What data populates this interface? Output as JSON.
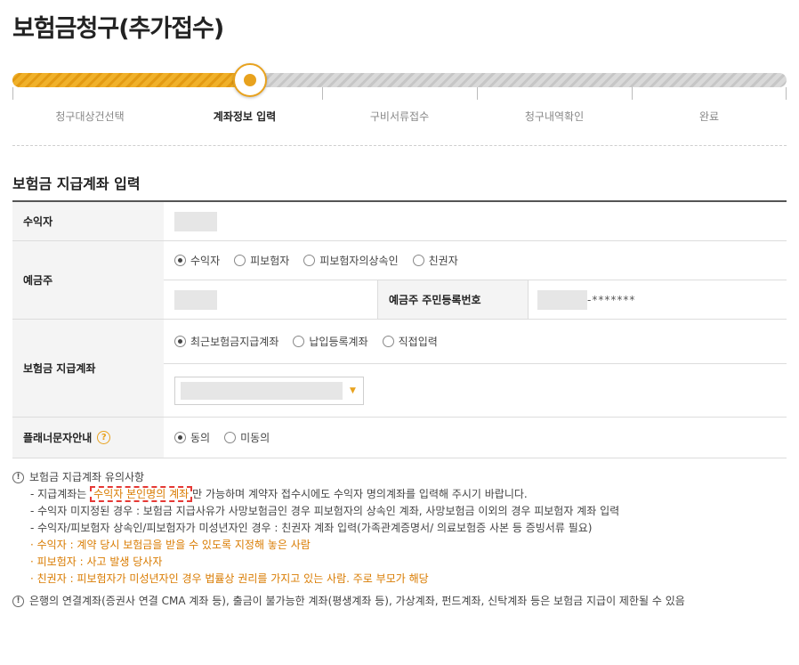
{
  "page": {
    "title": "보험금청구(추가접수)"
  },
  "progress": {
    "steps": [
      "청구대상건선택",
      "계좌정보 입력",
      "구비서류접수",
      "청구내역확인",
      "완료"
    ],
    "current_step": 2,
    "accent_color": "#e8a21e"
  },
  "section": {
    "title": "보험금 지급계좌 입력"
  },
  "form": {
    "beneficiary_label": "수익자",
    "account_holder_label": "예금주",
    "account_holder_options": [
      "수익자",
      "피보험자",
      "피보험자의상속인",
      "친권자"
    ],
    "account_holder_selected": "수익자",
    "resident_no_label": "예금주 주민등록번호",
    "resident_no_masked": "-*******",
    "payout_account_label": "보험금 지급계좌",
    "payout_account_options": [
      "최근보험금지급계좌",
      "납입등록계좌",
      "직접입력"
    ],
    "payout_account_selected": "최근보험금지급계좌",
    "planner_sms_label": "플래너문자안내",
    "planner_sms_options": [
      "동의",
      "미동의"
    ],
    "planner_sms_selected": "동의"
  },
  "notes": {
    "heading": "보험금 지급계좌 유의사항",
    "line1_pre": "- 지급계좌는 ",
    "line1_highlight": "수익자 본인명의 계좌",
    "line1_post": "만 가능하며 계약자 접수시에도 수익자 명의계좌를 입력해 주시기 바랍니다.",
    "line2": "- 수익자 미지정된 경우 : 보험금 지급사유가 사망보험금인 경우 피보험자의 상속인 계좌, 사망보험금 이외의 경우 피보험자 계좌 입력",
    "line3": "- 수익자/피보험자 상속인/피보험자가 미성년자인 경우 : 친권자 계좌 입력(가족관계증명서/ 의료보험증 사본 등 증빙서류 필요)",
    "line4": "· 수익자 : 계약 당시 보험금을 받을 수 있도록 지정해 놓은 사람",
    "line5": "· 피보험자 : 사고 발생 당사자",
    "line6": "· 친권자 : 피보험자가 미성년자인 경우 법률상 권리를 가지고 있는 사람. 주로 부모가 해당",
    "note2": "은행의 연결계좌(증권사 연결 CMA 계좌 등), 출금이 불가능한 계좌(평생계좌 등), 가상계좌, 펀드계좌, 신탁계좌 등은 보험금 지급이 제한될 수 있음"
  }
}
